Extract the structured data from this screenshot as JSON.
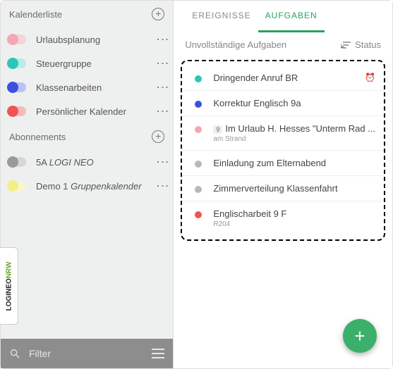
{
  "sidebar": {
    "sections": {
      "calendars_title": "Kalenderliste",
      "subscriptions_title": "Abonnements"
    },
    "calendars": [
      {
        "label": "Urlaubsplanung",
        "color": "#f4a6b3",
        "track": "#f3d4da",
        "knob_side": "left"
      },
      {
        "label": "Steuergruppe",
        "color": "#2cc6b6",
        "track": "#b9ece6",
        "knob_side": "left"
      },
      {
        "label": "Klassenarbeiten",
        "color": "#3b4fe0",
        "track": "#b9c2f3",
        "knob_side": "left"
      },
      {
        "label": "Persönlicher Kalender",
        "color": "#f15454",
        "track": "#f6bcbc",
        "knob_side": "left"
      }
    ],
    "subscriptions": [
      {
        "label_prefix": "5A ",
        "label_italic": "LOGI NEO",
        "color": "#9a9a9a",
        "track": "#d7d7d7",
        "knob_side": "left"
      },
      {
        "label_prefix": "Demo 1 ",
        "label_italic": "Gruppenkalender",
        "color": "#f2ef89",
        "track": "#f7f6cf",
        "knob_side": "left"
      }
    ],
    "filter_label": "Filter"
  },
  "brand": {
    "part1": "LOGINEO",
    "part2": "NRW"
  },
  "main": {
    "tabs": {
      "events": "EREIGNISSE",
      "tasks": "AUFGABEN",
      "active": "tasks"
    },
    "subheader": {
      "title": "Unvollständige Aufgaben",
      "status": "Status"
    },
    "tasks": [
      {
        "color": "#2cc6b6",
        "title": "Dringender Anruf BR",
        "sub": "",
        "alarm": true
      },
      {
        "color": "#3b4fe0",
        "title": "Korrektur Englisch 9a",
        "sub": ""
      },
      {
        "color": "#f4a6b3",
        "title": "Im Urlaub H. Hesses \"Unterm Rad ...",
        "sub": "am Strand",
        "badge": "9"
      },
      {
        "color": "#b8b8b8",
        "title": "Einladung zum Elternabend",
        "sub": ""
      },
      {
        "color": "#b8b8b8",
        "title": "Zimmerverteilung Klassenfahrt",
        "sub": ""
      },
      {
        "color": "#f15454",
        "title": "Englischarbeit 9 F",
        "sub": "R204"
      }
    ]
  },
  "icons": {
    "plus": "+",
    "search": "🔍",
    "menu": "≡",
    "dots": "⋮",
    "sort": "☰",
    "alarm": "⏰"
  }
}
